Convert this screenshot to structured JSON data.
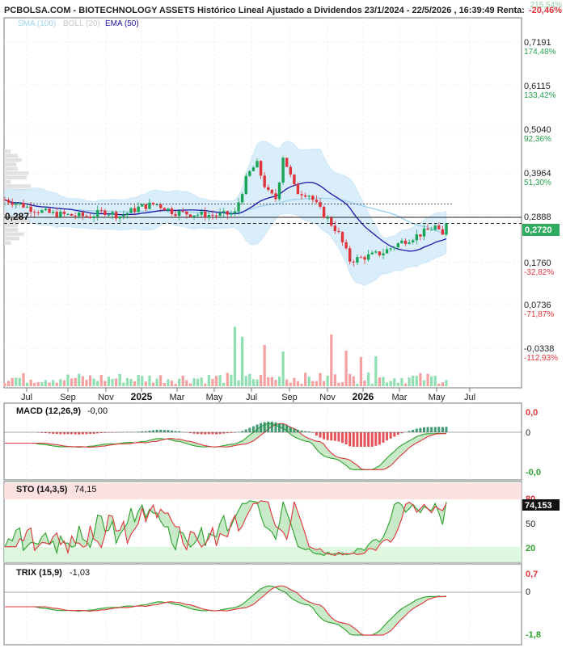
{
  "header": {
    "title": "PCBOLSA.COM - BIOTECHNOLOGY ASSETS Histórico Lineal Ajustado a Dividendos 23/1/2024 - 22/5/2026 , 16:39:49 Renta:",
    "renta": "-20,46%",
    "top_pct": "215,54%"
  },
  "legend": [
    {
      "label": "SMA (100)",
      "color": "#9fd3f0"
    },
    {
      "label": "BOLL (20)",
      "color": "#c8c8c8"
    },
    {
      "label": "EMA (50)",
      "color": "#1d16a8"
    }
  ],
  "colors": {
    "up": "#18a558",
    "down": "#e0343b",
    "vol_up": "#8fe0b0",
    "vol_down": "#f4a0a0",
    "ema": "#1d16a8",
    "sma": "#9fd3f0",
    "boll_fill": "#d7ecfa",
    "price_tag": "#2eab5f",
    "pct_pos": "#27a24f",
    "pct_neg": "#e0343b",
    "ind_green": "#2ca02c",
    "ind_red": "#e0343b"
  },
  "price_axis": [
    {
      "label": "0,7191",
      "pct": "174,48%"
    },
    {
      "label": "0,6115",
      "pct": "133,42%"
    },
    {
      "label": "0,5040",
      "pct": "92,36%"
    },
    {
      "label": "0,3964",
      "pct": "51,30%"
    },
    {
      "label": "0,2888",
      "pct": ""
    },
    {
      "label": "0,1760",
      "pct": "-32,82%"
    },
    {
      "label": "0,0736",
      "pct": "-71,87%"
    },
    {
      "label": "-0,0338",
      "pct": "-112,93%"
    }
  ],
  "reference_label": "0,287",
  "last_price": "0,2720",
  "months": [
    "Jul",
    "Sep",
    "Nov",
    "2025",
    "Mar",
    "May",
    "Jul",
    "Sep",
    "Nov",
    "2026",
    "Mar",
    "May",
    "Jul"
  ],
  "chart_data": {
    "type": "candlestick",
    "title": "BIOTECHNOLOGY ASSETS Histórico Lineal Ajustado a Dividendos",
    "x_range": [
      "2024-06",
      "2026-07"
    ],
    "ylim": [
      -0.0338,
      0.7191
    ],
    "close_series_approx": [
      {
        "x": "2024-06-20",
        "close": 0.33
      },
      {
        "x": "2024-07-10",
        "close": 0.322
      },
      {
        "x": "2024-08-01",
        "close": 0.308
      },
      {
        "x": "2024-09-01",
        "close": 0.296
      },
      {
        "x": "2024-10-01",
        "close": 0.292
      },
      {
        "x": "2024-11-01",
        "close": 0.289
      },
      {
        "x": "2024-11-25",
        "close": 0.302
      },
      {
        "x": "2024-12-20",
        "close": 0.29
      },
      {
        "x": "2025-01-20",
        "close": 0.312
      },
      {
        "x": "2025-02-15",
        "close": 0.32
      },
      {
        "x": "2025-03-15",
        "close": 0.3
      },
      {
        "x": "2025-04-15",
        "close": 0.295
      },
      {
        "x": "2025-05-20",
        "close": 0.292
      },
      {
        "x": "2025-06-20",
        "close": 0.296
      },
      {
        "x": "2025-07-10",
        "close": 0.39
      },
      {
        "x": "2025-07-25",
        "close": 0.42
      },
      {
        "x": "2025-08-10",
        "close": 0.35
      },
      {
        "x": "2025-08-25",
        "close": 0.332
      },
      {
        "x": "2025-09-05",
        "close": 0.44
      },
      {
        "x": "2025-09-25",
        "close": 0.35
      },
      {
        "x": "2025-10-15",
        "close": 0.345
      },
      {
        "x": "2025-11-05",
        "close": 0.3
      },
      {
        "x": "2025-12-01",
        "close": 0.25
      },
      {
        "x": "2025-12-20",
        "close": 0.18
      },
      {
        "x": "2026-01-15",
        "close": 0.19
      },
      {
        "x": "2026-02-10",
        "close": 0.2
      },
      {
        "x": "2026-03-10",
        "close": 0.225
      },
      {
        "x": "2026-04-10",
        "close": 0.245
      },
      {
        "x": "2026-05-05",
        "close": 0.265
      },
      {
        "x": "2026-05-15",
        "close": 0.235
      },
      {
        "x": "2026-05-22",
        "close": 0.272
      }
    ],
    "indicators": {
      "macd": {
        "label": "MACD (12,26,9)",
        "value": "-0,00",
        "axis": [
          "0,0",
          "0",
          "-0,0"
        ]
      },
      "sto": {
        "label": "STO (14,3,5)",
        "value": "74,15",
        "axis": [
          "80",
          "50",
          "20"
        ],
        "last": "74,153"
      },
      "trix": {
        "label": "TRIX (15,9)",
        "value": "-1,03",
        "axis": [
          "0,7",
          "0",
          "-1,8"
        ]
      }
    }
  }
}
